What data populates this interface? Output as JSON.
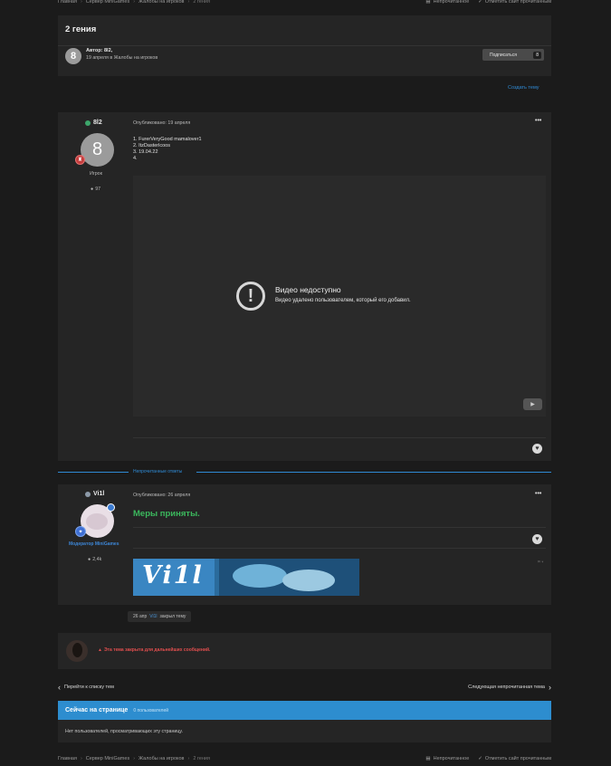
{
  "breadcrumbs": {
    "items": [
      "Главная",
      "Сервер MiniGames",
      "Жалобы на игроков",
      "2 гения"
    ],
    "unread": "Непрочитанное",
    "mark_read": "Отметить сайт прочитанным"
  },
  "topic": {
    "title": "2 гения",
    "avatar_letter": "8",
    "author_line": "Автор: 8l2,",
    "date_line": "19 апреля в Жалобы на игроков",
    "subscribe_label": "Подписаться",
    "subscribe_count": "8",
    "create_topic": "Создать тему"
  },
  "post1": {
    "username": "8l2",
    "avatar_letter": "8",
    "role": "Игрок",
    "posts_count": "97",
    "published": "Опубликовано: 19 апреля",
    "lines": [
      "1. FurerVeryGood mamalover1",
      "2. ItzDasterlcoos",
      "3. 19.04.22",
      "4."
    ],
    "video_title": "Видео недоступно",
    "video_text": "Видео удалено пользователем, который его добавил."
  },
  "unread_separator": "Непрочитанные ответы",
  "post2": {
    "username": "Vi1l",
    "role": "Модератор MiniGames",
    "posts_count": "2,4k",
    "published": "Опубликовано: 26 апреля",
    "message": "Меры приняты.",
    "signature_text": "Vi1l"
  },
  "closed_event": {
    "date": "26 апр",
    "user": "Vi1l",
    "action": "закрыл тему"
  },
  "closed_notice": "Эта тема закрыта для дальнейших сообщений.",
  "nav": {
    "back": "Перейти к списку тем",
    "next": "Следующая непрочитанная тема"
  },
  "online": {
    "title": "Сейчас на странице",
    "count": "0 пользователей",
    "empty": "Нет пользователей, просматривающих эту страницу."
  },
  "colors": {
    "accent": "#2f8ad4",
    "success": "#3bb85d",
    "danger": "#e04e4e"
  }
}
